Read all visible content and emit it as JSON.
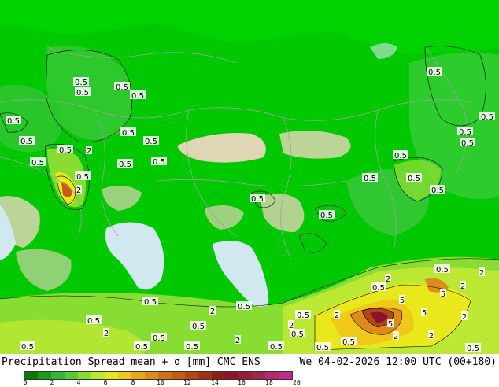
{
  "header": {
    "title": "Precipitation Spread mean + σ [mm] CMC ENS",
    "datetime": "We 04-02-2026 12:00 UTC (00+180)"
  },
  "colorbar": {
    "colors": [
      "#0a7a0a",
      "#1a9a1a",
      "#33b833",
      "#55cc33",
      "#88dd33",
      "#bbe833",
      "#e8e81a",
      "#f0c81a",
      "#e8a81a",
      "#dd8c1a",
      "#d2701a",
      "#c85a14",
      "#b44614",
      "#a03214",
      "#8c2014",
      "#8c1428",
      "#961e3c",
      "#a02850",
      "#b4286e",
      "#c8288c"
    ],
    "ticks": [
      "0",
      "2",
      "4",
      "6",
      "8",
      "10",
      "12",
      "14",
      "16",
      "18",
      "20"
    ]
  },
  "map": {
    "colors": {
      "base_green": "#00c800",
      "bright_green": "#00dc00",
      "dark_green": "#009e00",
      "yellow_green": "#b4e632",
      "yellow": "#f0f032",
      "orange": "#f0a01e",
      "red": "#c83214",
      "dark_red": "#8c1414",
      "land_tan": "#ded6b4",
      "water_blue": "#d2e8f0",
      "border_gray": "#a0a0a0"
    },
    "contour_labels": [
      "0.5",
      "0.5",
      "0.5",
      "0.5",
      "0.5",
      "0.5",
      "0.5",
      "0.5",
      "0.5",
      "0.5",
      "0.5",
      "2",
      "0.5",
      "0.5",
      "0.5",
      "0.5",
      "0.5",
      "0.5",
      "0.5",
      "0.5",
      "0.5",
      "0.5",
      "0.5",
      "0.5",
      "0.5",
      "0.5",
      "0.5",
      "0.5",
      "0.5",
      "2",
      "2",
      "2",
      "2",
      "2",
      "2",
      "2",
      "2",
      "2",
      "2",
      "2",
      "5",
      "5",
      "5",
      "5",
      "2",
      "0.5",
      "0.5",
      "0.5",
      "0.5",
      "0.5",
      "0.5",
      "0.5",
      "0.5",
      "0.5",
      "0.5",
      "0.5"
    ]
  }
}
